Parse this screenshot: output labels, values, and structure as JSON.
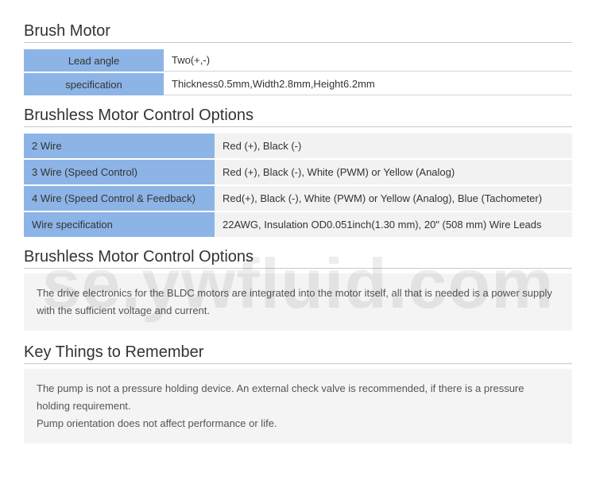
{
  "section1": {
    "title": "Brush Motor",
    "rows": [
      {
        "label": "Lead angle",
        "value": "Two(+,-)"
      },
      {
        "label": "specification",
        "value": "Thickness0.5mm,Width2.8mm,Height6.2mm"
      }
    ]
  },
  "section2": {
    "title": "Brushless Motor Control Options",
    "rows": [
      {
        "label": "2 Wire",
        "value": "Red (+), Black (-)"
      },
      {
        "label": "3 Wire (Speed Control)",
        "value": "Red (+), Black (-), White (PWM) or Yellow (Analog)"
      },
      {
        "label": "4 Wire (Speed Control & Feedback)",
        "value": "Red(+), Black (-), White (PWM) or Yellow (Analog), Blue (Tachometer)"
      },
      {
        "label": "Wire specification",
        "value": "22AWG, Insulation OD0.051inch(1.30 mm), 20\" (508 mm) Wire Leads"
      }
    ]
  },
  "section3": {
    "title": "Brushless Motor Control Options",
    "note": "The drive electronics for the BLDC motors are integrated into the motor itself, all that is needed is a power supply with the sufficient voltage and current."
  },
  "section4": {
    "title": "Key Things to Remember",
    "note": "The pump is not a pressure holding device. An external check valve is recommended, if there is a pressure holding requirement.\nPump orientation does not affect performance or life."
  },
  "watermark": "se.ywfluid.com"
}
